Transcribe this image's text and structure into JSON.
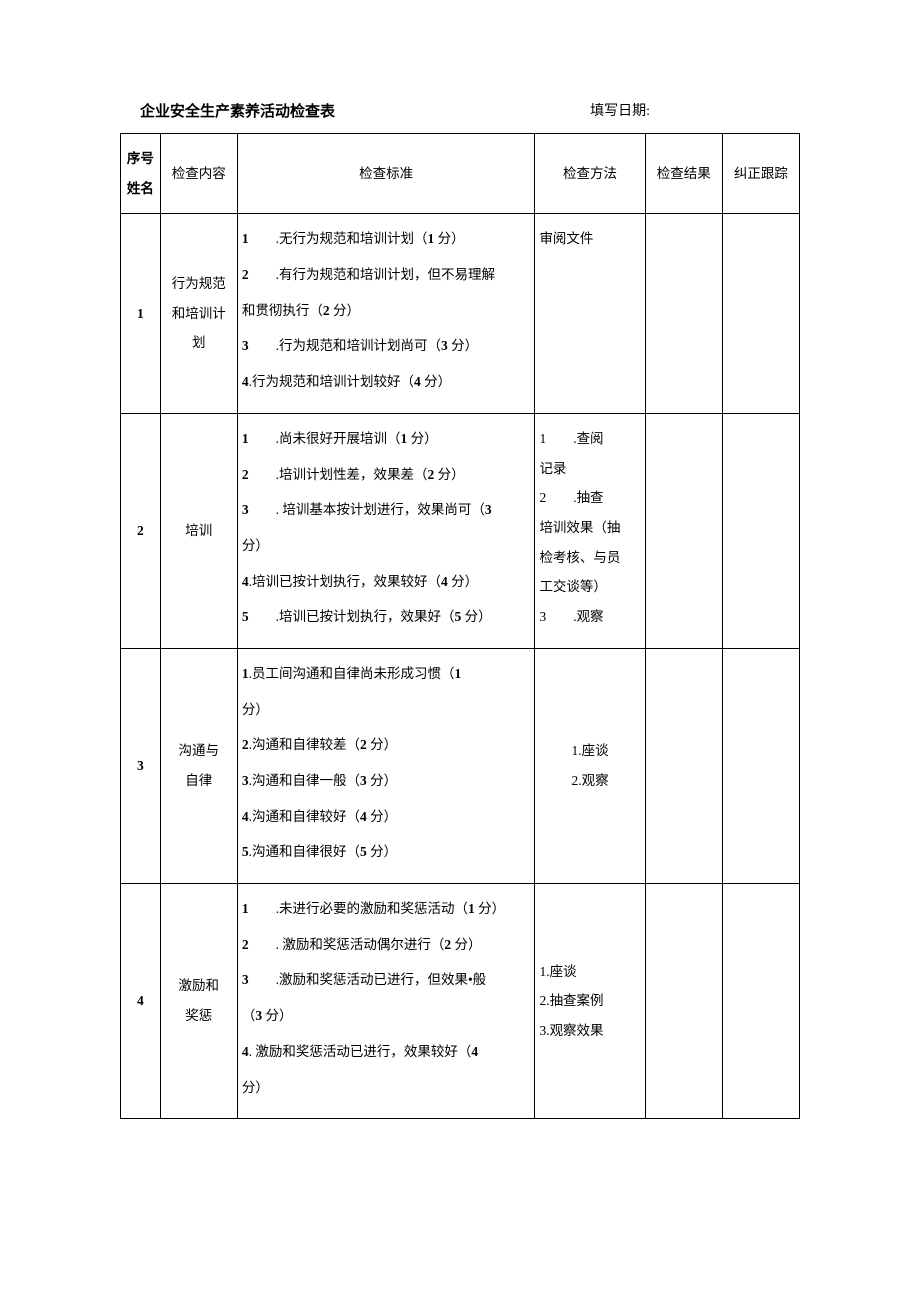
{
  "header": {
    "title": "企业安全生产素养活动检查表",
    "dateLabel": "填写日期:"
  },
  "columns": {
    "seq": "序号",
    "name": "姓名",
    "content": "检查内容",
    "standard": "检查标准",
    "method": "检查方法",
    "result": "检查结果",
    "track": "纠正跟踪"
  },
  "rows": [
    {
      "seq": "1",
      "content": "行为规范和培训计划",
      "standard": "1  .无行为规范和培训计划（1 分）\n2  .有行为规范和培训计划，但不易理解\n和贯彻执行（2 分）\n3  .行为规范和培训计划尚可（3 分）\n4.行为规范和培训计划较好（4 分）",
      "method": "审阅文件",
      "methodAlign": "top"
    },
    {
      "seq": "2",
      "content": "培训",
      "standard": "1  .尚未很好开展培训（1 分）\n2  .培训计划性差，效果差（2 分）\n3  . 培训基本按计划进行，效果尚可（3\n分）\n4.培训已按计划执行，效果较好（4 分）\n5  .培训已按计划执行，效果好（5 分）",
      "method": "1  .查阅\n记录\n2  .抽查\n培训效果（抽\n检考核、与员\n工交谈等）\n3  .观察",
      "methodAlign": "top"
    },
    {
      "seq": "3",
      "content": "沟通与自律",
      "standard": "1.员工间沟通和自律尚未形成习惯（1\n分）\n2.沟通和自律较差（2 分）\n3.沟通和自律一般（3 分）\n4.沟通和自律较好（4 分）\n5.沟通和自律很好（5 分）",
      "method": "1.座谈\n2.观察",
      "methodAlign": "center"
    },
    {
      "seq": "4",
      "content": "激励和奖惩",
      "standard": "1  .未进行必要的激励和奖惩活动（1 分）\n2  . 激励和奖惩活动偶尔进行（2 分）\n3  .激励和奖惩活动已进行，但效果•般\n（3 分）\n4. 激励和奖惩活动已进行，效果较好（4\n分）",
      "method": "1.座谈\n2.抽查案例\n3.观察效果",
      "methodAlign": "middle"
    }
  ]
}
